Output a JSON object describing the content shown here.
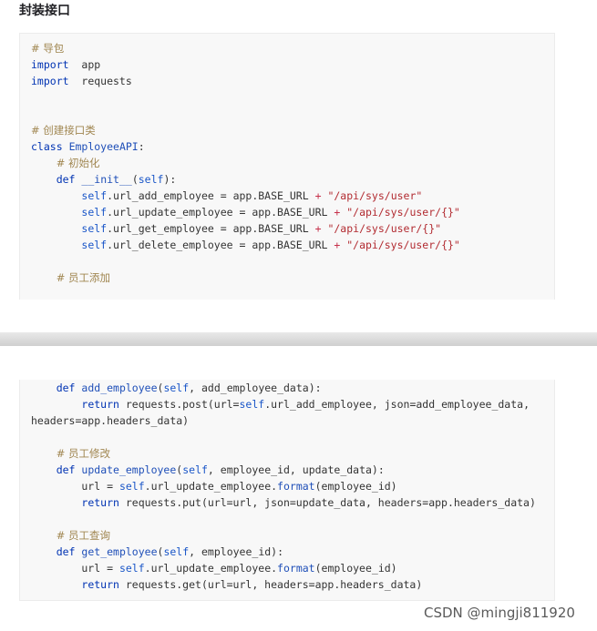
{
  "heading": "封装接口",
  "block1": [
    {
      "segs": [
        [
          "cm",
          "# 导包"
        ]
      ]
    },
    {
      "segs": [
        [
          "kw",
          "import"
        ],
        [
          "",
          "  app"
        ]
      ]
    },
    {
      "segs": [
        [
          "kw",
          "import"
        ],
        [
          "",
          "  requests"
        ]
      ]
    },
    {
      "segs": []
    },
    {
      "segs": []
    },
    {
      "segs": [
        [
          "cm",
          "# 创建接口类"
        ]
      ]
    },
    {
      "segs": [
        [
          "kw",
          "class"
        ],
        [
          "",
          " "
        ],
        [
          "fn",
          "EmployeeAPI"
        ],
        [
          "",
          ":"
        ]
      ]
    },
    {
      "segs": [
        [
          "",
          "    "
        ],
        [
          "cm",
          "# 初始化"
        ]
      ]
    },
    {
      "segs": [
        [
          "",
          "    "
        ],
        [
          "kw",
          "def"
        ],
        [
          "",
          " "
        ],
        [
          "fn",
          "__init__"
        ],
        [
          "",
          "("
        ],
        [
          "self",
          "self"
        ],
        [
          "",
          "):"
        ]
      ]
    },
    {
      "segs": [
        [
          "",
          "        "
        ],
        [
          "self",
          "self"
        ],
        [
          "",
          ".url_add_employee = app.BASE_URL "
        ],
        [
          "op",
          "+"
        ],
        [
          "",
          " "
        ],
        [
          "str",
          "\"/api/sys/user\""
        ]
      ]
    },
    {
      "segs": [
        [
          "",
          "        "
        ],
        [
          "self",
          "self"
        ],
        [
          "",
          ".url_update_employee = app.BASE_URL "
        ],
        [
          "op",
          "+"
        ],
        [
          "",
          " "
        ],
        [
          "str",
          "\"/api/sys/user/{}\""
        ]
      ]
    },
    {
      "segs": [
        [
          "",
          "        "
        ],
        [
          "self",
          "self"
        ],
        [
          "",
          ".url_get_employee = app.BASE_URL "
        ],
        [
          "op",
          "+"
        ],
        [
          "",
          " "
        ],
        [
          "str",
          "\"/api/sys/user/{}\""
        ]
      ]
    },
    {
      "segs": [
        [
          "",
          "        "
        ],
        [
          "self",
          "self"
        ],
        [
          "",
          ".url_delete_employee = app.BASE_URL "
        ],
        [
          "op",
          "+"
        ],
        [
          "",
          " "
        ],
        [
          "str",
          "\"/api/sys/user/{}\""
        ]
      ]
    },
    {
      "segs": []
    },
    {
      "segs": [
        [
          "",
          "    "
        ],
        [
          "cm",
          "# 员工添加"
        ]
      ]
    }
  ],
  "block2": [
    {
      "segs": [
        [
          "",
          "    "
        ],
        [
          "kw",
          "def"
        ],
        [
          "",
          " "
        ],
        [
          "fn",
          "add_employee"
        ],
        [
          "",
          "("
        ],
        [
          "self",
          "self"
        ],
        [
          "",
          ", add_employee_data):"
        ]
      ]
    },
    {
      "segs": [
        [
          "",
          "        "
        ],
        [
          "kw",
          "return"
        ],
        [
          "",
          " requests.post(url="
        ],
        [
          "self",
          "self"
        ],
        [
          "",
          ".url_add_employee, json=add_employee_data,"
        ]
      ]
    },
    {
      "segs": [
        [
          "",
          "headers=app.headers_data)"
        ]
      ]
    },
    {
      "segs": []
    },
    {
      "segs": [
        [
          "",
          "    "
        ],
        [
          "cm",
          "# 员工修改"
        ]
      ]
    },
    {
      "segs": [
        [
          "",
          "    "
        ],
        [
          "kw",
          "def"
        ],
        [
          "",
          " "
        ],
        [
          "fn",
          "update_employee"
        ],
        [
          "",
          "("
        ],
        [
          "self",
          "self"
        ],
        [
          "",
          ", employee_id, update_data):"
        ]
      ]
    },
    {
      "segs": [
        [
          "",
          "        url = "
        ],
        [
          "self",
          "self"
        ],
        [
          "",
          ".url_update_employee."
        ],
        [
          "fn",
          "format"
        ],
        [
          "",
          "(employee_id)"
        ]
      ]
    },
    {
      "segs": [
        [
          "",
          "        "
        ],
        [
          "kw",
          "return"
        ],
        [
          "",
          " requests.put(url=url, json=update_data, headers=app.headers_data)"
        ]
      ]
    },
    {
      "segs": []
    },
    {
      "segs": [
        [
          "",
          "    "
        ],
        [
          "cm",
          "# 员工查询"
        ]
      ]
    },
    {
      "segs": [
        [
          "",
          "    "
        ],
        [
          "kw",
          "def"
        ],
        [
          "",
          " "
        ],
        [
          "fn",
          "get_employee"
        ],
        [
          "",
          "("
        ],
        [
          "self",
          "self"
        ],
        [
          "",
          ", employee_id):"
        ]
      ]
    },
    {
      "segs": [
        [
          "",
          "        url = "
        ],
        [
          "self",
          "self"
        ],
        [
          "",
          ".url_update_employee."
        ],
        [
          "fn",
          "format"
        ],
        [
          "",
          "(employee_id)"
        ]
      ]
    },
    {
      "segs": [
        [
          "",
          "        "
        ],
        [
          "kw",
          "return"
        ],
        [
          "",
          " requests.get(url=url, headers=app.headers_data)"
        ]
      ]
    }
  ],
  "watermark": "CSDN @mingji811920"
}
